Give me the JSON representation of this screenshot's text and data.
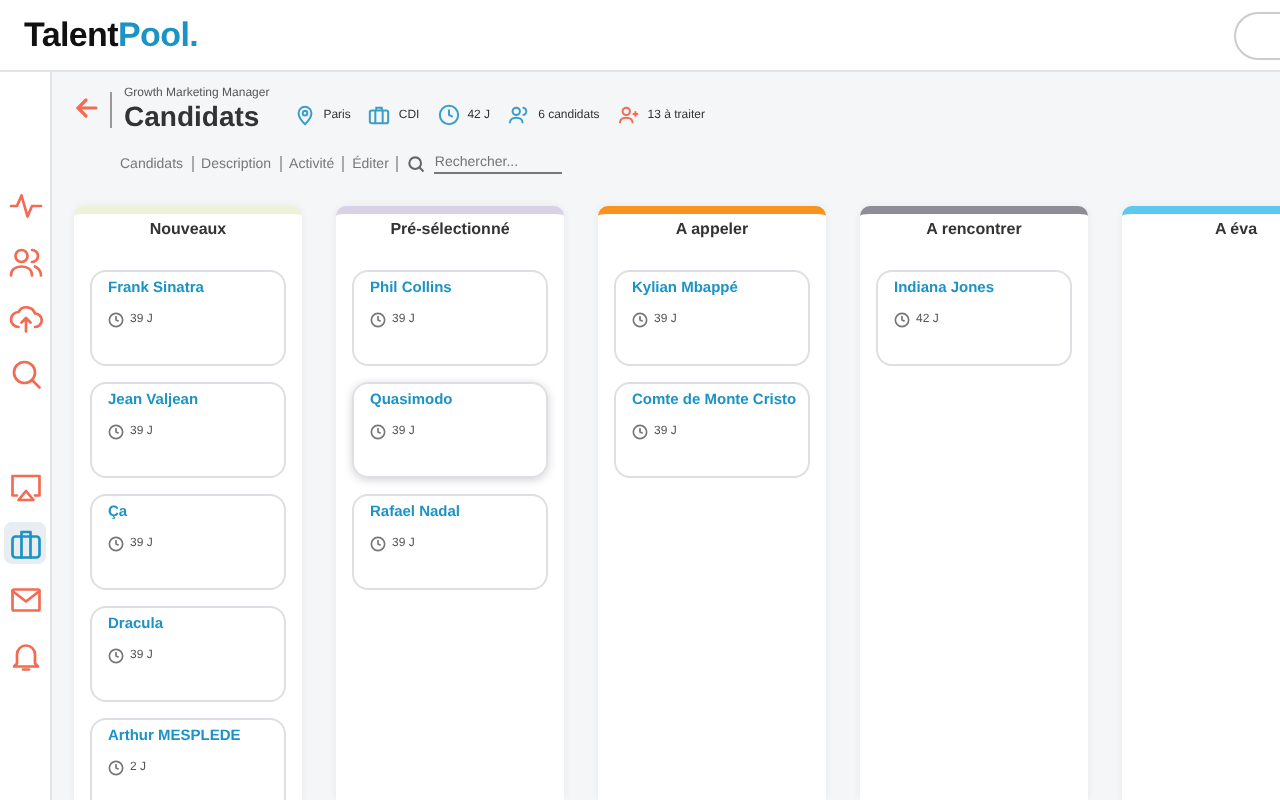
{
  "logo": {
    "part_1": "Talent",
    "part_2": "Pool."
  },
  "sidebar": {
    "items": [
      {
        "kind": "activity",
        "selected": false
      },
      {
        "kind": "users",
        "selected": false
      },
      {
        "kind": "upload",
        "selected": false
      },
      {
        "kind": "search",
        "selected": false
      },
      {
        "kind": "screen",
        "selected": false
      },
      {
        "kind": "briefcase",
        "selected": true
      },
      {
        "kind": "mail",
        "selected": false
      },
      {
        "kind": "bell",
        "selected": false
      }
    ]
  },
  "job": {
    "subtitle": "Growth Marketing Manager",
    "title": "Candidats",
    "location": "Paris",
    "contract": "CDI",
    "age": "42 J",
    "candidates": "6 candidats",
    "to_process": "13 à traiter"
  },
  "nav": {
    "links": [
      "Candidats",
      "Description",
      "Activité",
      "Éditer"
    ],
    "search": {
      "placeholder": "Rechercher..."
    }
  },
  "columns": [
    {
      "title": "Nouveaux",
      "color": "#eef2d8",
      "cards": [
        {
          "name": "Frank Sinatra",
          "age": "39 J",
          "selected": false
        },
        {
          "name": "Jean Valjean",
          "age": "39 J",
          "selected": false
        },
        {
          "name": "Ça",
          "age": "39 J",
          "selected": false
        },
        {
          "name": "Dracula",
          "age": "39 J",
          "selected": false
        },
        {
          "name": "Arthur MESPLEDE",
          "age": "2 J",
          "selected": false
        }
      ]
    },
    {
      "title": "Pré-sélectionné",
      "color": "#d9d2e6",
      "cards": [
        {
          "name": "Phil Collins",
          "age": "39 J",
          "selected": false
        },
        {
          "name": "Quasimodo",
          "age": "39 J",
          "selected": true
        },
        {
          "name": "Rafael Nadal",
          "age": "39 J",
          "selected": false
        }
      ]
    },
    {
      "title": "A appeler",
      "color": "#f7931e",
      "cards": [
        {
          "name": "Kylian Mbappé",
          "age": "39 J",
          "selected": false
        },
        {
          "name": "Comte de Monte Cristo",
          "age": "39 J",
          "selected": false
        }
      ]
    },
    {
      "title": "A rencontrer",
      "color": "#8e8c94",
      "cards": [
        {
          "name": "Indiana Jones",
          "age": "42 J",
          "selected": false
        }
      ]
    },
    {
      "title": "A éva",
      "color": "#5bc8f0"
    }
  ]
}
